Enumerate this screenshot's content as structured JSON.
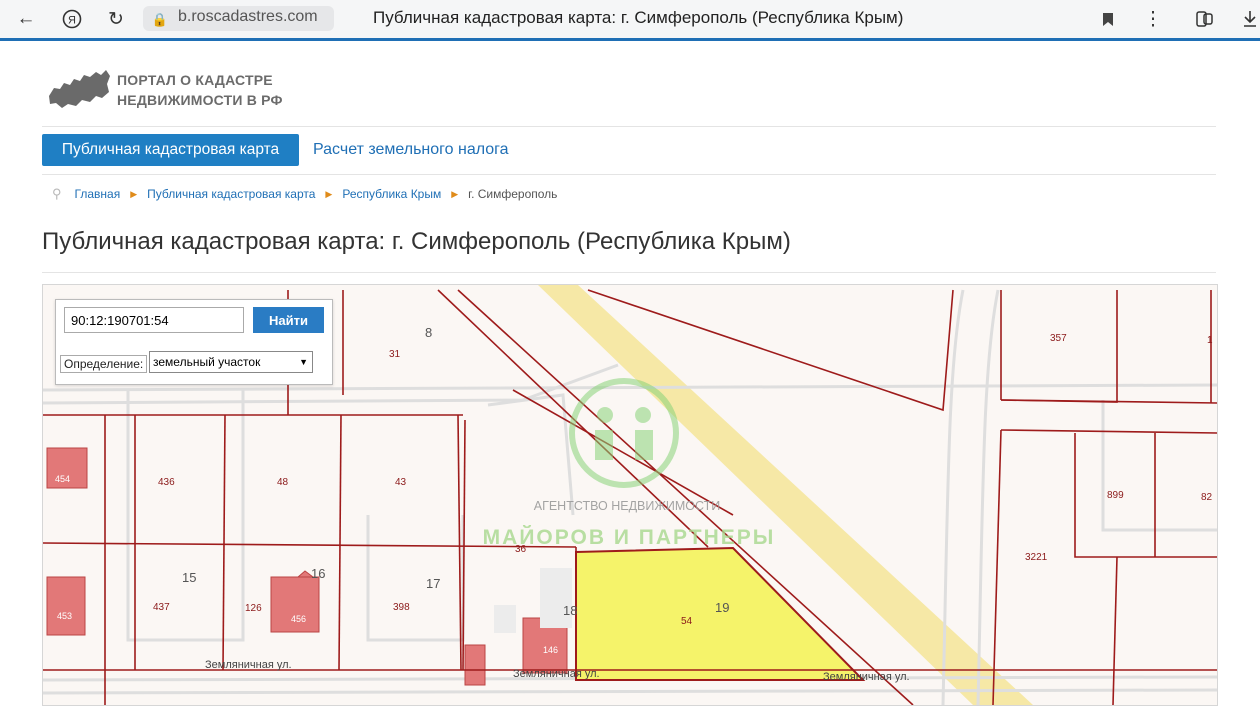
{
  "browser": {
    "url": "b.roscadastres.com",
    "tab_title": "Публичная кадастровая карта: г. Симферополь (Республика Крым)"
  },
  "logo": {
    "line1": "ПОРТАЛ О КАДАСТРЕ",
    "line2": "НЕДВИЖИМОСТИ В РФ"
  },
  "nav": {
    "active": "Публичная кадастровая карта",
    "link": "Расчет земельного налога"
  },
  "breadcrumbs": [
    "Главная",
    "Публичная кадастровая карта",
    "Республика Крым",
    "г. Симферополь"
  ],
  "page_title": "Публичная кадастровая карта: г. Симферополь (Республика Крым)",
  "map": {
    "search_value": "90:12:190701:54",
    "search_button": "Найти",
    "definition_label": "Определение:",
    "definition_value": "земельный участок",
    "watermark_line1": "АГЕНТСТВО НЕДВИЖИМОСТИ",
    "watermark_line2": "МАЙОРОВ И ПАРТНЕРЫ",
    "parcels": {
      "p31": "31",
      "p8": "8",
      "p357": "357",
      "p1": "1",
      "p436": "436",
      "p48": "48",
      "p43": "43",
      "p454": "454",
      "p899": "899",
      "p82": "82",
      "p36": "36",
      "p3221": "3221",
      "p15": "15",
      "p16": "16",
      "p17": "17",
      "p437": "437",
      "p126": "126",
      "p456": "456",
      "p398": "398",
      "p18": "18",
      "p19": "19",
      "p54": "54",
      "p453": "453",
      "p146": "146"
    },
    "streets": {
      "s1": "Земляничная ул.",
      "s2": "Земляничная ул.",
      "s3": "Земляничная ул."
    }
  },
  "colors": {
    "accent": "#1f7fc4",
    "highlight_parcel": "#f5f36a",
    "parcel_line": "#9e1b1b",
    "building": "#e27878",
    "road": "#f6e8a6"
  }
}
